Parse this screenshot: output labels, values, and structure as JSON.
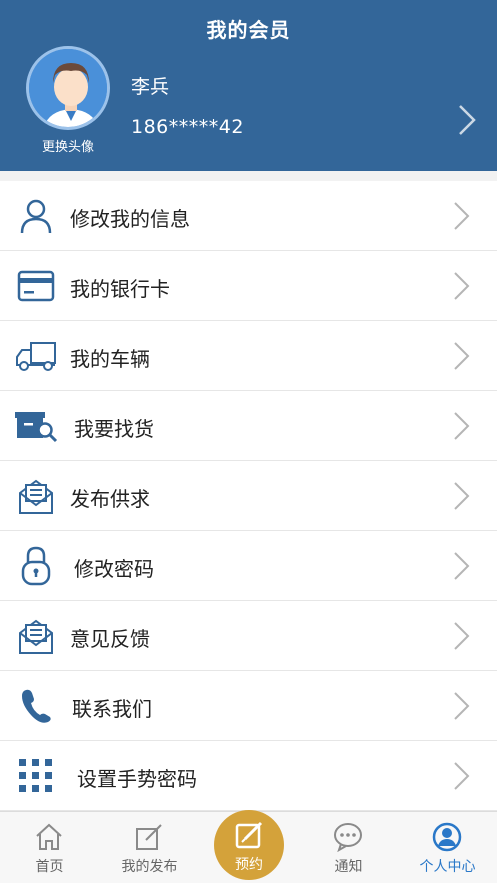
{
  "header": {
    "title": "我的会员",
    "avatar_label": "更换头像",
    "user_name": "李兵",
    "user_phone": "186*****42"
  },
  "colors": {
    "header_bg": "#336699",
    "icon_blue": "#336699",
    "accent_gold": "#d4a23a",
    "active_tab": "#2a78c8"
  },
  "menu": {
    "items": [
      {
        "label": "修改我的信息",
        "icon": "user-icon"
      },
      {
        "label": "我的银行卡",
        "icon": "bank-card-icon"
      },
      {
        "label": "我的车辆",
        "icon": "truck-icon"
      },
      {
        "label": "我要找货",
        "icon": "find-cargo-icon"
      },
      {
        "label": "发布供求",
        "icon": "publish-mail-icon"
      },
      {
        "label": "修改密码",
        "icon": "lock-icon"
      },
      {
        "label": "意见反馈",
        "icon": "feedback-mail-icon"
      },
      {
        "label": "联系我们",
        "icon": "phone-icon"
      },
      {
        "label": "设置手势密码",
        "icon": "gesture-grid-icon"
      }
    ]
  },
  "tabbar": {
    "tabs": [
      {
        "label": "首页",
        "icon": "home-icon"
      },
      {
        "label": "我的发布",
        "icon": "edit-icon"
      },
      {
        "label": "预约",
        "icon": "reserve-icon"
      },
      {
        "label": "通知",
        "icon": "chat-icon"
      },
      {
        "label": "个人中心",
        "icon": "person-icon"
      }
    ],
    "active": "个人中心"
  }
}
